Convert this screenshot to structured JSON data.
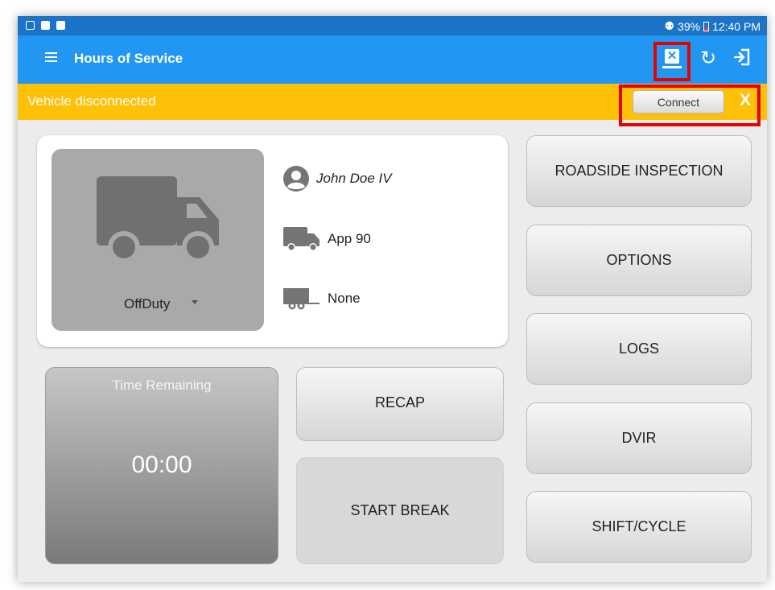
{
  "status_bar": {
    "battery": "39%",
    "time": "12:40 PM"
  },
  "app_bar": {
    "title": "Hours of Service"
  },
  "banner": {
    "message": "Vehicle disconnected",
    "connect_label": "Connect",
    "close_label": "X"
  },
  "driver_card": {
    "duty_status": "OffDuty",
    "driver_name": "John Doe IV",
    "vehicle": "App 90",
    "trailer": "None"
  },
  "time_remaining": {
    "label": "Time Remaining",
    "value": "00:00"
  },
  "actions": {
    "recap": "RECAP",
    "start_break": "START BREAK"
  },
  "side_menu": [
    {
      "label": "ROADSIDE INSPECTION"
    },
    {
      "label": "OPTIONS"
    },
    {
      "label": "LOGS"
    },
    {
      "label": "DVIR"
    },
    {
      "label": "SHIFT/CYCLE"
    }
  ],
  "colors": {
    "status_bar": "#1b74c8",
    "app_bar": "#2196f3",
    "banner": "#ffc107",
    "highlight": "#e60000",
    "status_tile": "#a9a9a9"
  }
}
